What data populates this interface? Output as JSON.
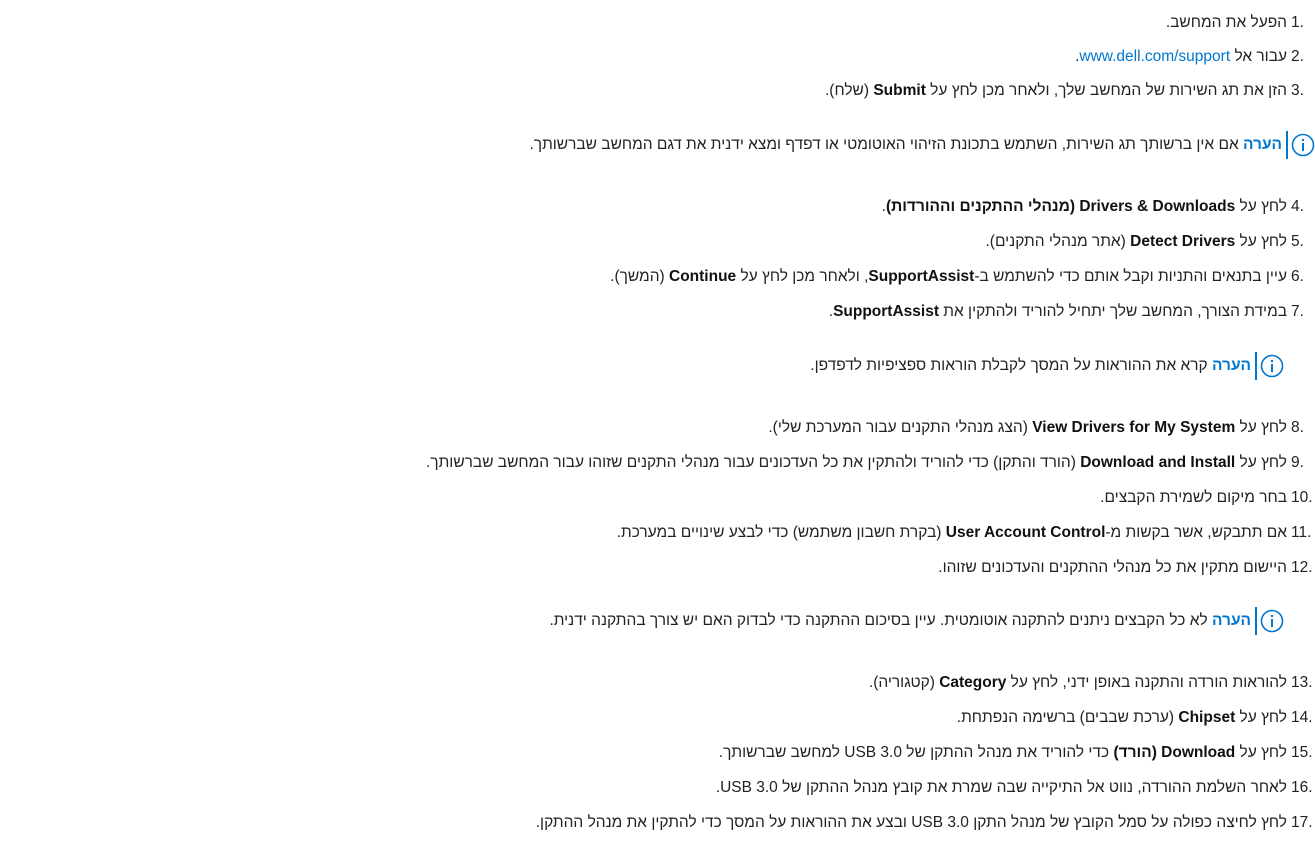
{
  "steps": [
    {
      "n": "1.",
      "text": "הפעל את המחשב."
    },
    {
      "n": "2.",
      "pre": "עבור אל ",
      "link": "www.dell.com/support",
      "post": "."
    },
    {
      "n": "3.",
      "pre": "הזן את תג השירות של המחשב שלך, ולאחר מכן לחץ על ",
      "bold": "Submit",
      "post": " (שלח)."
    },
    {
      "n": "4.",
      "pre": "לחץ על ",
      "bold": "Drivers & Downloads (מנהלי ההתקנים וההורדות)",
      "post": "."
    },
    {
      "n": "5.",
      "pre": "לחץ על ",
      "bold": "Detect Drivers",
      "post": " (אתר מנהלי התקנים)."
    },
    {
      "n": "6.",
      "pre": "עיין בתנאים והתניות וקבל אותם כדי להשתמש ב-",
      "bold": "SupportAssist",
      "mid": ", ולאחר מכן לחץ על ",
      "bold2": "Continue",
      "post": " (המשך)."
    },
    {
      "n": "7.",
      "pre": "במידת הצורך, המחשב שלך יתחיל להוריד ולהתקין את ",
      "bold": "SupportAssist",
      "post": "."
    },
    {
      "n": "8.",
      "pre": "לחץ על ",
      "bold": "View Drivers for My System",
      "post": " (הצג מנהלי התקנים עבור המערכת שלי)."
    },
    {
      "n": "9.",
      "pre": "לחץ על ",
      "bold": "Download and Install",
      "post": " (הורד והתקן) כדי להוריד ולהתקין את כל העדכונים עבור מנהלי התקנים שזוהו עבור המחשב שברשותך."
    },
    {
      "n": "10.",
      "text": "בחר מיקום לשמירת הקבצים."
    },
    {
      "n": "11.",
      "pre": "אם תתבקש, אשר בקשות מ-",
      "bold": "User Account Control",
      "post": " (בקרת חשבון משתמש) כדי לבצע שינויים במערכת."
    },
    {
      "n": "12.",
      "text": "היישום מתקין את כל מנהלי ההתקנים והעדכונים שזוהו."
    },
    {
      "n": "13.",
      "pre": "להוראות הורדה והתקנה באופן ידני, לחץ על ",
      "bold": "Category",
      "post": " (קטגוריה)."
    },
    {
      "n": "14.",
      "pre": "לחץ על ",
      "bold": "Chipset",
      "post": " (ערכת שבבים) ברשימה הנפתחת."
    },
    {
      "n": "15.",
      "pre": "לחץ על ",
      "bold": "Download (הורד)",
      "post": " כדי להוריד את מנהל ההתקן של USB 3.0 למחשב שברשותך."
    },
    {
      "n": "16.",
      "text": "לאחר השלמת ההורדה, נווט אל התיקייה שבה שמרת את קובץ מנהל ההתקן של USB 3.0."
    },
    {
      "n": "17.",
      "text": "לחץ לחיצה כפולה על סמל הקובץ של מנהל התקן USB 3.0 ובצע את ההוראות על המסך כדי להתקין את מנהל ההתקן."
    }
  ],
  "notes": [
    {
      "label": "הערה",
      "text": " אם אין ברשותך תג השירות, השתמש בתכונת הזיהוי האוטומטי או דפדף ומצא ידנית את דגם המחשב שברשותך."
    },
    {
      "label": "הערה",
      "text": " קרא את ההוראות על המסך לקבלת הוראות ספציפיות לדפדפן."
    },
    {
      "label": "הערה",
      "text": " לא כל הקבצים ניתנים להתקנה אוטומטית. עיין בסיכום ההתקנה כדי לבדוק האם יש צורך בהתקנה ידנית."
    }
  ],
  "colors": {
    "accent": "#0076ce",
    "text": "#222222"
  },
  "icons": {
    "note": "info-circle-icon"
  }
}
